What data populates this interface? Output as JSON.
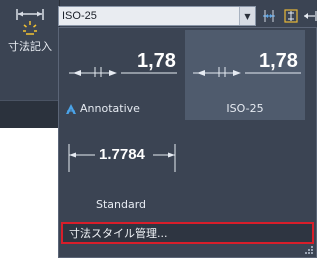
{
  "ribbon": {
    "dimension_tool_label": "寸法記入"
  },
  "toolbar": {
    "style_select_value": "ISO-25"
  },
  "dropdown": {
    "tiles": [
      {
        "name": "Annotative",
        "preview_value": "1,78",
        "selected": false
      },
      {
        "name": "ISO-25",
        "preview_value": "1,78",
        "selected": true
      },
      {
        "name": "Standard",
        "preview_value": "1.7784",
        "selected": false
      }
    ],
    "manage_label": "寸法スタイル管理..."
  },
  "colors": {
    "panel_bg": "#3b4453",
    "selected_tile": "#4f5b6d",
    "highlight_border": "#d81e2a",
    "annotative_icon": "#4aa3e8"
  }
}
